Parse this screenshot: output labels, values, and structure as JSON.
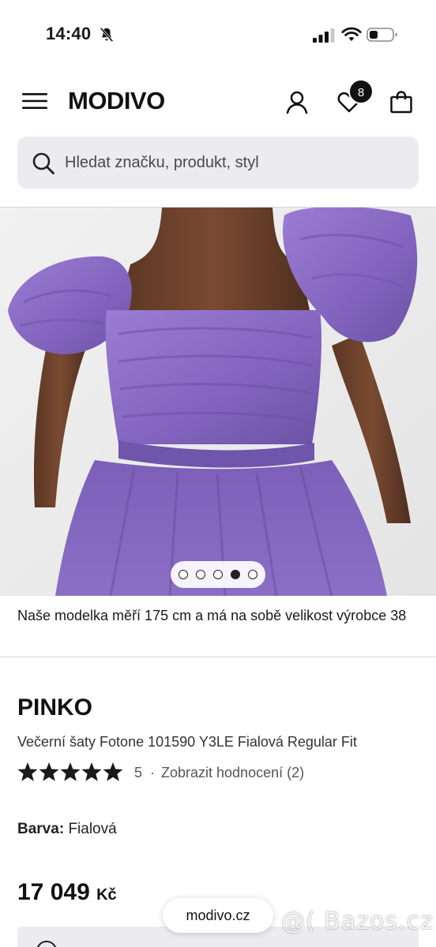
{
  "status_bar": {
    "time": "14:40",
    "icons": [
      "bell-muted-icon",
      "signal-icon",
      "wifi-icon",
      "battery-icon"
    ]
  },
  "header": {
    "logo": "MODIVO",
    "wishlist_count": "8",
    "icons": [
      "menu-icon",
      "account-icon",
      "heart-icon",
      "bag-icon"
    ]
  },
  "search": {
    "placeholder": "Hledat značku, produkt, styl",
    "value": ""
  },
  "gallery": {
    "dots_total": 5,
    "active_dot": 4
  },
  "model_note": "Naše modelka měří 175 cm a má na sobě velikost výrobce 38",
  "product": {
    "brand": "PINKO",
    "name": "Večerní šaty Fotone 101590 Y3LE Fialová Regular Fit",
    "rating_stars": 5,
    "rating_value": "5",
    "rating_separator": "·",
    "reviews_link": "Zobrazit hodnocení (2)",
    "color_label": "Barva:",
    "color_value": "Fialová",
    "price": "17 049",
    "currency": "Kč"
  },
  "browser": {
    "domain": "modivo.cz"
  },
  "watermark": "@( Bazos.cz",
  "colors": {
    "accent": "#111111",
    "search_bg": "#ecebef",
    "dress_purple": "#8a6cc2"
  }
}
